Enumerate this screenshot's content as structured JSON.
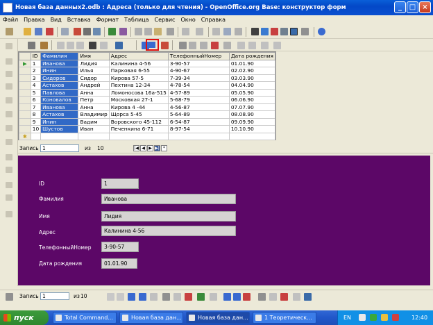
{
  "window": {
    "title": "Новая база данных2.odb : Адреса (только для чтения) - OpenOffice.org Base: конструктор форм"
  },
  "menu": [
    "Файл",
    "Правка",
    "Вид",
    "Вставка",
    "Формат",
    "Таблица",
    "Сервис",
    "Окно",
    "Справка"
  ],
  "table": {
    "columns": [
      "ID",
      "Фамилия",
      "Имя",
      "Адрес",
      "ТелефонныйНомер",
      "Дата рождения"
    ],
    "rows": [
      [
        "1",
        "Иванова",
        "Лидия",
        "Калинина 4-56",
        "3-90-57",
        "01.01.90"
      ],
      [
        "2",
        "Инин",
        "Илья",
        "Парковая 6-55",
        "4-90-67",
        "02.02.90"
      ],
      [
        "3",
        "Сидоров",
        "Сидор",
        "Кирова 57-5",
        "7-39-34",
        "03.03.90"
      ],
      [
        "4",
        "Астахов",
        "Андрей",
        "Пехтина 12-34",
        "4-78-54",
        "04.04.90"
      ],
      [
        "5",
        "Павлова",
        "Анна",
        "Ломоносова 16а-515",
        "4-57-89",
        "05.05.90"
      ],
      [
        "6",
        "Коновалов",
        "Петр",
        "Московкая 27-1",
        "5-68-79",
        "06.06.90"
      ],
      [
        "7",
        "Иванова",
        "Анна",
        "Кирова 4 -44",
        "4-56-87",
        "07.07.90"
      ],
      [
        "8",
        "Астахов",
        "Владимир",
        "Щорса 5-45",
        "5-64-89",
        "08.08.90"
      ],
      [
        "9",
        "Инин",
        "Вадим",
        "Воровского 45-112",
        "6-54-87",
        "09.09.90"
      ],
      [
        "10",
        "Шустов",
        "Иван",
        "Печенкина 6-71",
        "8-97-54",
        "10.10.90"
      ]
    ]
  },
  "nav_table": {
    "label": "Запись",
    "value": "1",
    "of_label": "из",
    "total": "10"
  },
  "nav_form": {
    "label": "Запись",
    "value": "1",
    "of_label": "из",
    "total": "10"
  },
  "form": {
    "fields": [
      {
        "label": "ID",
        "value": "1"
      },
      {
        "label": "Фамилия",
        "value": "Иванова"
      },
      {
        "label": "Имя",
        "value": "Лидия"
      },
      {
        "label": "Адрес",
        "value": "Калинина 4-56"
      },
      {
        "label": "ТелефонныйНомер",
        "value": "3-90-57"
      },
      {
        "label": "Дата рождения",
        "value": "01.01.90"
      }
    ]
  },
  "taskbar": {
    "start_label": "пуск",
    "tasks": [
      "Total Command...",
      "Новая база дан...",
      "Новая база дан...",
      "1 Теоретическ..."
    ],
    "lang": "EN",
    "clock": "12:40"
  },
  "colors": {
    "form_bg": "#5c0767",
    "selected_column": "#3169c6",
    "highlight_box": "#e01010"
  }
}
